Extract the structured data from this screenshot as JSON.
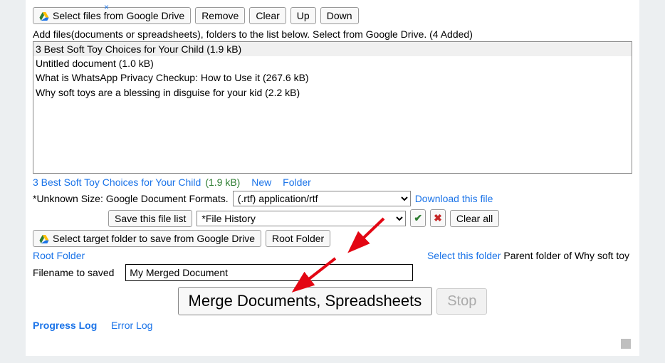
{
  "top": {
    "close_x": "×",
    "select_files": "Select files from Google Drive",
    "remove": "Remove",
    "clear": "Clear",
    "up": "Up",
    "down": "Down"
  },
  "instruction": "Add files(documents or spreadsheets), folders to the list below. Select from Google Drive. (4 Added)",
  "list": [
    "3 Best Soft Toy Choices for Your Child (1.9 kB)",
    "Untitled document (1.0 kB)",
    "What is WhatsApp Privacy Checkup: How to Use it (267.6 kB)",
    "Why soft toys are a blessing in disguise for your kid (2.2 kB)"
  ],
  "selected": {
    "name": "3 Best Soft Toy Choices for Your Child",
    "size": "(1.9 kB)",
    "new_link": "New",
    "folder_link": "Folder"
  },
  "formats_label": "*Unknown Size: Google Document Formats.",
  "format_select_value": "(.rtf) application/rtf",
  "download_link": "Download this file",
  "save_file_list_btn": "Save this file list",
  "file_history_value": "*File History",
  "clear_all_btn": "Clear all",
  "select_target_btn": "Select target folder to save from Google Drive",
  "root_folder_btn": "Root Folder",
  "root_folder_link": "Root Folder",
  "select_this_folder_link": "Select this folder",
  "parent_folder_text": "Parent folder of Why soft toy",
  "filename_label": "Filename to saved",
  "filename_value": "My Merged Document",
  "merge_btn": "Merge Documents, Spreadsheets",
  "stop_btn": "Stop",
  "progress_log": "Progress Log",
  "error_log": "Error Log"
}
